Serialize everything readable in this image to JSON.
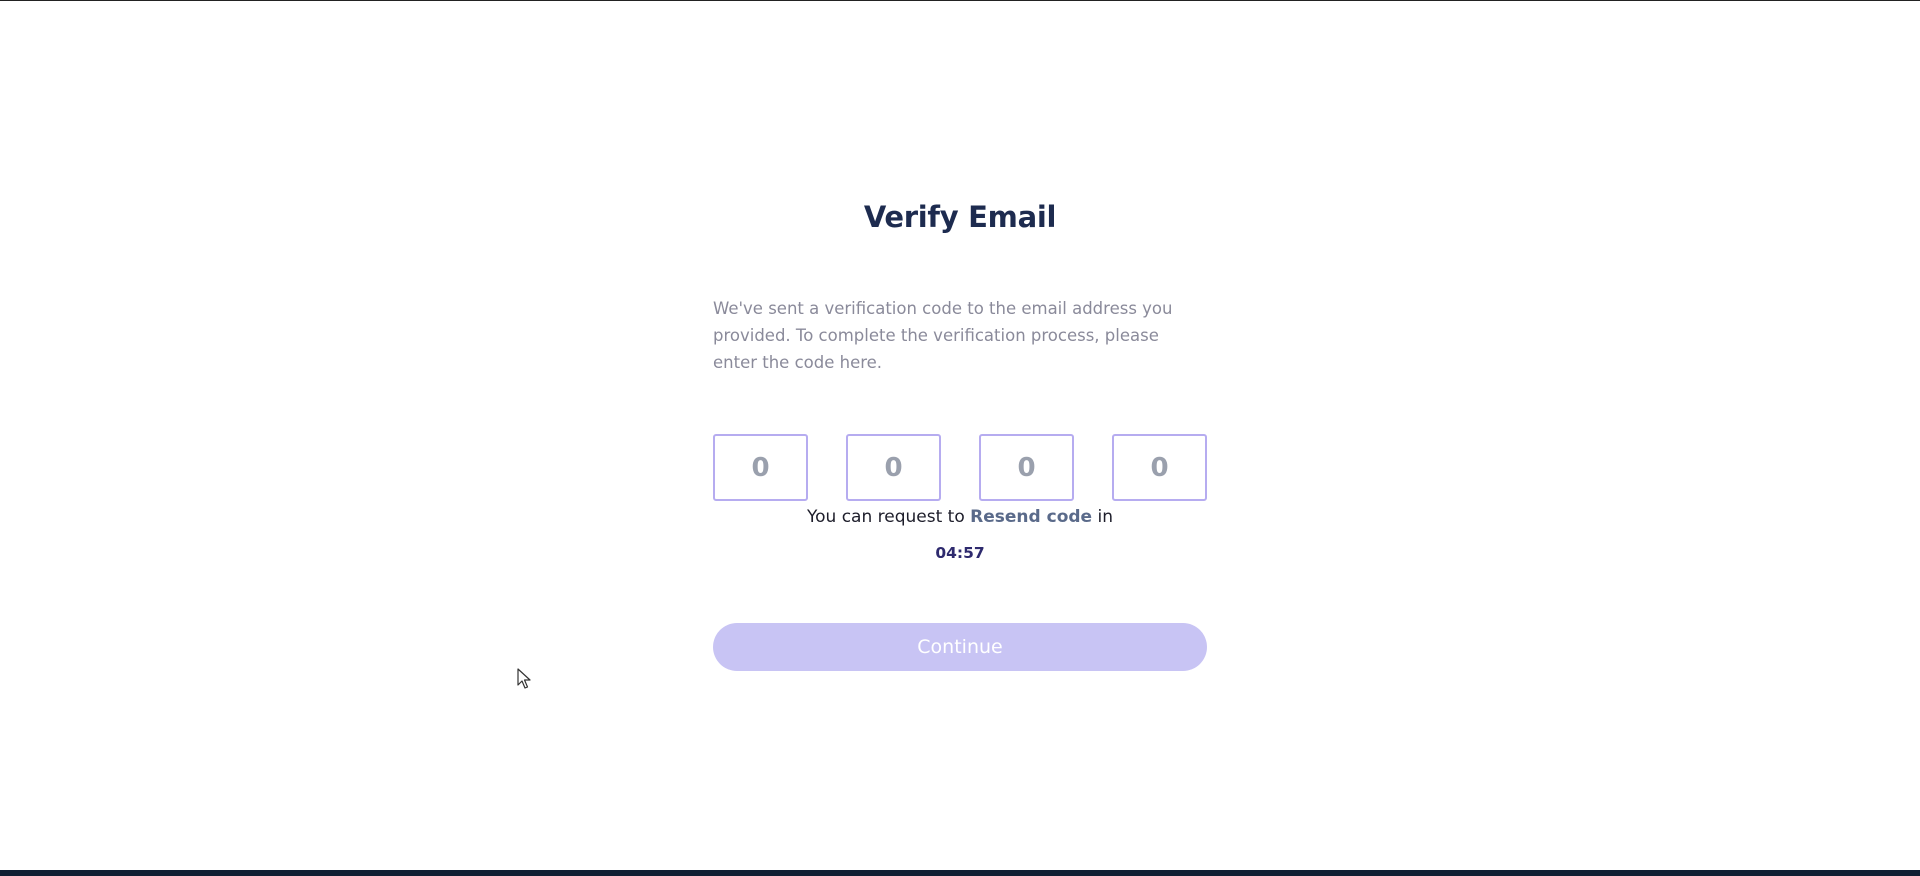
{
  "verify": {
    "title": "Verify Email",
    "description": "We've sent a verification code to the email address you provided. To complete the verification process, please enter the code here.",
    "otp_placeholders": [
      "0",
      "0",
      "0",
      "0"
    ],
    "resend_prefix": "You can request to",
    "resend_link": "Resend code",
    "resend_suffix": "in",
    "timer": "04:57",
    "continue_label": "Continue"
  },
  "colors": {
    "title": "#1d2b4f",
    "otp_border": "#b6acf0",
    "button_bg": "#c8c4f4",
    "timer": "#2e2a6e"
  }
}
